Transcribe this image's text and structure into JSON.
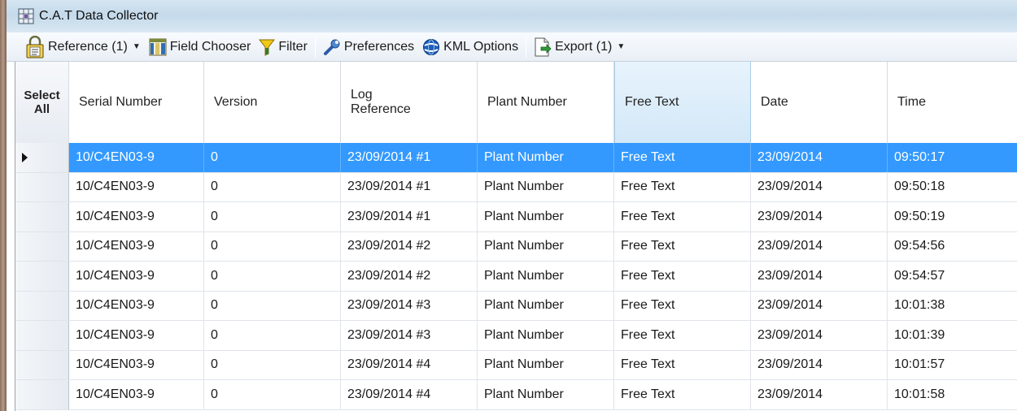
{
  "window": {
    "title": "C.A.T Data Collector"
  },
  "toolbar": {
    "reference_label": "Reference (1)",
    "field_chooser_label": "Field Chooser",
    "filter_label": "Filter",
    "preferences_label": "Preferences",
    "kml_options_label": "KML Options",
    "export_label": "Export (1)"
  },
  "grid": {
    "select_all_line1": "Select",
    "select_all_line2": "All",
    "columns": {
      "serial": "Serial Number",
      "version": "Version",
      "log_ref_line1": "Log",
      "log_ref_line2": "Reference",
      "plant": "Plant Number",
      "free_text": "Free Text",
      "date": "Date",
      "time": "Time"
    },
    "rows": [
      {
        "serial": "10/C4EN03-9",
        "version": "0",
        "log_ref": "23/09/2014 #1",
        "plant": "Plant Number",
        "free_text": "Free Text",
        "date": "23/09/2014",
        "time": "09:50:17"
      },
      {
        "serial": "10/C4EN03-9",
        "version": "0",
        "log_ref": "23/09/2014 #1",
        "plant": "Plant Number",
        "free_text": "Free Text",
        "date": "23/09/2014",
        "time": "09:50:18"
      },
      {
        "serial": "10/C4EN03-9",
        "version": "0",
        "log_ref": "23/09/2014 #1",
        "plant": "Plant Number",
        "free_text": "Free Text",
        "date": "23/09/2014",
        "time": "09:50:19"
      },
      {
        "serial": "10/C4EN03-9",
        "version": "0",
        "log_ref": "23/09/2014 #2",
        "plant": "Plant Number",
        "free_text": "Free Text",
        "date": "23/09/2014",
        "time": "09:54:56"
      },
      {
        "serial": "10/C4EN03-9",
        "version": "0",
        "log_ref": "23/09/2014 #2",
        "plant": "Plant Number",
        "free_text": "Free Text",
        "date": "23/09/2014",
        "time": "09:54:57"
      },
      {
        "serial": "10/C4EN03-9",
        "version": "0",
        "log_ref": "23/09/2014 #3",
        "plant": "Plant Number",
        "free_text": "Free Text",
        "date": "23/09/2014",
        "time": "10:01:38"
      },
      {
        "serial": "10/C4EN03-9",
        "version": "0",
        "log_ref": "23/09/2014 #3",
        "plant": "Plant Number",
        "free_text": "Free Text",
        "date": "23/09/2014",
        "time": "10:01:39"
      },
      {
        "serial": "10/C4EN03-9",
        "version": "0",
        "log_ref": "23/09/2014 #4",
        "plant": "Plant Number",
        "free_text": "Free Text",
        "date": "23/09/2014",
        "time": "10:01:57"
      },
      {
        "serial": "10/C4EN03-9",
        "version": "0",
        "log_ref": "23/09/2014 #4",
        "plant": "Plant Number",
        "free_text": "Free Text",
        "date": "23/09/2014",
        "time": "10:01:58"
      }
    ],
    "selected_row": 0,
    "colors": {
      "selection": "#3399ff",
      "sorted_header": "#d3e8f8"
    }
  }
}
